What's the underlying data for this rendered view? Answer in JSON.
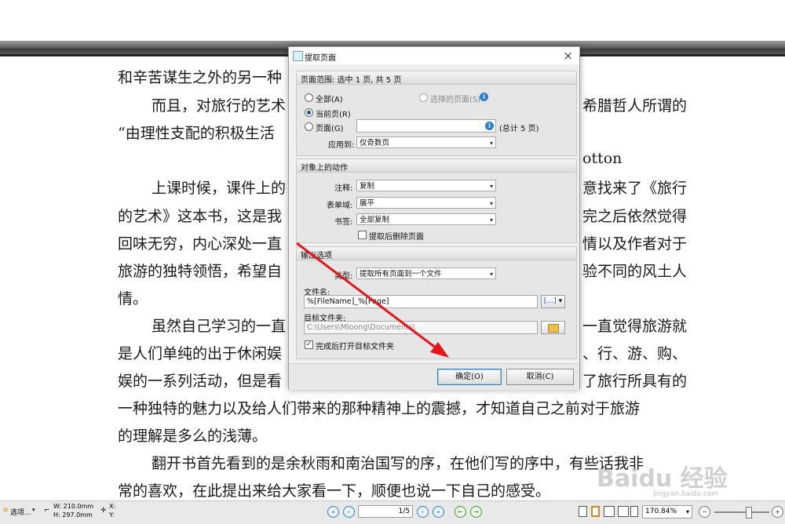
{
  "document": {
    "lines": [
      "和辛苦谋生之外的另一种",
      "而且，对旅行的艺术",
      "希腊哲人所谓的",
      "“由理性支配的积极生活",
      "otton",
      "上课时候，课件上的",
      "意找来了《旅行",
      "的艺术》这本书，这是我",
      "完之后依然觉得",
      "回味无穷，内心深处一直",
      "情以及作者对于",
      "旅游的独特领悟，希望自",
      "验不同的风土人",
      "情。",
      "虽然自己学习的一直",
      "一直觉得旅游就",
      "是人们单纯的出于休闲娱",
      "、行、游、购、",
      "娱的一系列活动，但是看",
      "了旅行所具有的",
      "一种独特的魅力以及给人们带来的那种精神上的震撼，才知道自己之前对于旅游",
      "的理解是多么的浅薄。",
      "翻开书首先看到的是余秋雨和南治国写的序，在他们写的序中，有些话我非",
      "常的喜欢，在此提出来给大家看一下，顺便也说一下自己的感受。"
    ]
  },
  "dialog": {
    "title": "提取页面",
    "close": "×",
    "page_range": {
      "header": "页面范围: 选中 1 页, 共 5 页",
      "all": "全部(A)",
      "selected_pages": "选择的页面(S)",
      "current": "当前页(R)",
      "pages": "页面(G)",
      "pages_value": "",
      "total": "(总计 5 页)",
      "apply_label": "应用到:",
      "apply_value": "仅奇数页"
    },
    "object_actions": {
      "header": "对象上的动作",
      "annotation_label": "注释:",
      "annotation_value": "复制",
      "form_label": "表单域:",
      "form_value": "展平",
      "bookmark_label": "书签:",
      "bookmark_value": "全部复制",
      "delete_after": "提取后删除页面"
    },
    "output": {
      "header": "输出选项",
      "type_label": "类型:",
      "type_value": "提取所有页面到一个文件",
      "filename_label": "文件名:",
      "filename_value": "%[FileName]_%[Page]",
      "macro_button": "[…]",
      "folder_label": "目标文件夹:",
      "folder_value": "C:\\Users\\Mloong\\Documents\\",
      "open_folder": "完成后打开目标文件夹"
    },
    "ok": "确定(O)",
    "cancel": "取消(C)"
  },
  "statusbar": {
    "options": "选项...",
    "width": "W: 210.0mm",
    "height": "H: 297.0mm",
    "x": "X:",
    "y": "Y:",
    "page_display": "1/5",
    "zoom": "170.84%"
  },
  "watermark": {
    "text": "Baidu 经验",
    "sub": "jingyan.baidu.com"
  },
  "colors": {
    "arrow": "#e8141b",
    "accent": "#2a7fd4"
  }
}
